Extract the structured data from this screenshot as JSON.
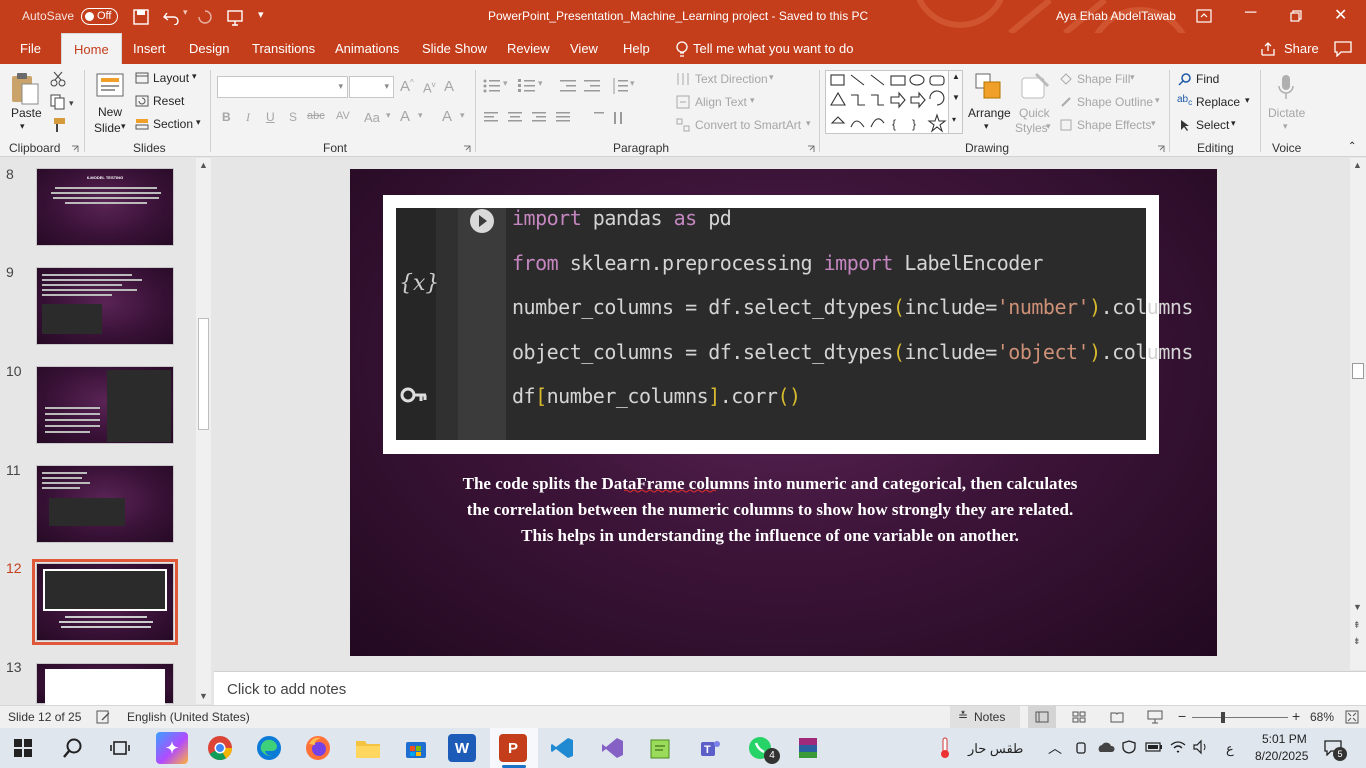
{
  "titlebar": {
    "autosave_label": "AutoSave",
    "autosave_state": "Off",
    "doc_title": "PowerPoint_Presentation_Machine_Learning project  -  Saved to this PC",
    "user": "Aya Ehab AbdelTawab"
  },
  "tabs": [
    "File",
    "Home",
    "Insert",
    "Design",
    "Transitions",
    "Animations",
    "Slide Show",
    "Review",
    "View",
    "Help"
  ],
  "tell_me": "Tell me what you want to do",
  "share": "Share",
  "ribbon": {
    "clipboard": {
      "paste": "Paste",
      "label": "Clipboard"
    },
    "slides": {
      "new_slide_1": "New",
      "new_slide_2": "Slide",
      "layout": "Layout",
      "reset": "Reset",
      "section": "Section",
      "label": "Slides"
    },
    "font": {
      "label": "Font",
      "aa": "Aa",
      "bold": "B",
      "italic": "I",
      "underline": "U",
      "shadow": "S",
      "strike": "abc",
      "spacing": "AV",
      "clear": "A"
    },
    "paragraph": {
      "text_direction": "Text Direction",
      "align_text": "Align Text",
      "smartart": "Convert to SmartArt",
      "label": "Paragraph"
    },
    "drawing": {
      "arrange": "Arrange",
      "quick_styles_1": "Quick",
      "quick_styles_2": "Styles",
      "shape_fill": "Shape Fill",
      "shape_outline": "Shape Outline",
      "shape_effects": "Shape Effects",
      "label": "Drawing"
    },
    "editing": {
      "find": "Find",
      "replace": "Replace",
      "select": "Select",
      "label": "Editing"
    },
    "voice": {
      "dictate": "Dictate",
      "label": "Voice"
    }
  },
  "thumbnails": [
    {
      "num": "8",
      "title": "6-MODEL TESTING",
      "selected": false
    },
    {
      "num": "9",
      "selected": false
    },
    {
      "num": "10",
      "selected": false
    },
    {
      "num": "11",
      "selected": false
    },
    {
      "num": "12",
      "selected": true
    },
    {
      "num": "13",
      "selected": false
    }
  ],
  "slide": {
    "code_lines": [
      [
        {
          "t": "import",
          "c": "kw"
        },
        {
          "t": " pandas ",
          "c": ""
        },
        {
          "t": "as",
          "c": "kw"
        },
        {
          "t": " pd",
          "c": ""
        }
      ],
      [
        {
          "t": "from",
          "c": "kw"
        },
        {
          "t": " sklearn.preprocessing ",
          "c": ""
        },
        {
          "t": "import",
          "c": "kw"
        },
        {
          "t": " LabelEncoder",
          "c": ""
        }
      ],
      [
        {
          "t": "number_columns = df.select_dtypes",
          "c": ""
        },
        {
          "t": "(",
          "c": "par"
        },
        {
          "t": "include=",
          "c": ""
        },
        {
          "t": "'number'",
          "c": "str"
        },
        {
          "t": ")",
          "c": "par"
        },
        {
          "t": ".columns",
          "c": ""
        }
      ],
      [
        {
          "t": "object_columns = df.select_dtypes",
          "c": ""
        },
        {
          "t": "(",
          "c": "par"
        },
        {
          "t": "include=",
          "c": ""
        },
        {
          "t": "'object'",
          "c": "str"
        },
        {
          "t": ")",
          "c": "par"
        },
        {
          "t": ".columns",
          "c": ""
        }
      ],
      [
        {
          "t": "df",
          "c": ""
        },
        {
          "t": "[",
          "c": "par"
        },
        {
          "t": "number_columns",
          "c": ""
        },
        {
          "t": "]",
          "c": "par"
        },
        {
          "t": ".corr",
          "c": ""
        },
        {
          "t": "()",
          "c": "par"
        }
      ]
    ],
    "caption": "The code splits the DataFrame columns into numeric and categorical, then calculates the correlation between the numeric columns to show how strongly they are related. This helps in understanding the influence of one variable on another."
  },
  "notes_placeholder": "Click to add notes",
  "status": {
    "slide_of": "Slide 12 of 25",
    "language": "English (United States)",
    "notes": "Notes",
    "zoom": "68%",
    "zoom_level": 0.68
  },
  "taskbar": {
    "weather": "طقس حار",
    "lang": "ع",
    "time": "5:01 PM",
    "date": "8/20/2025",
    "notif": "5",
    "whatsapp_badge": "4"
  },
  "colors": {
    "accent": "#c43e1c",
    "slide_bg": "#3d1439",
    "code_bg": "#2b2b2b"
  }
}
